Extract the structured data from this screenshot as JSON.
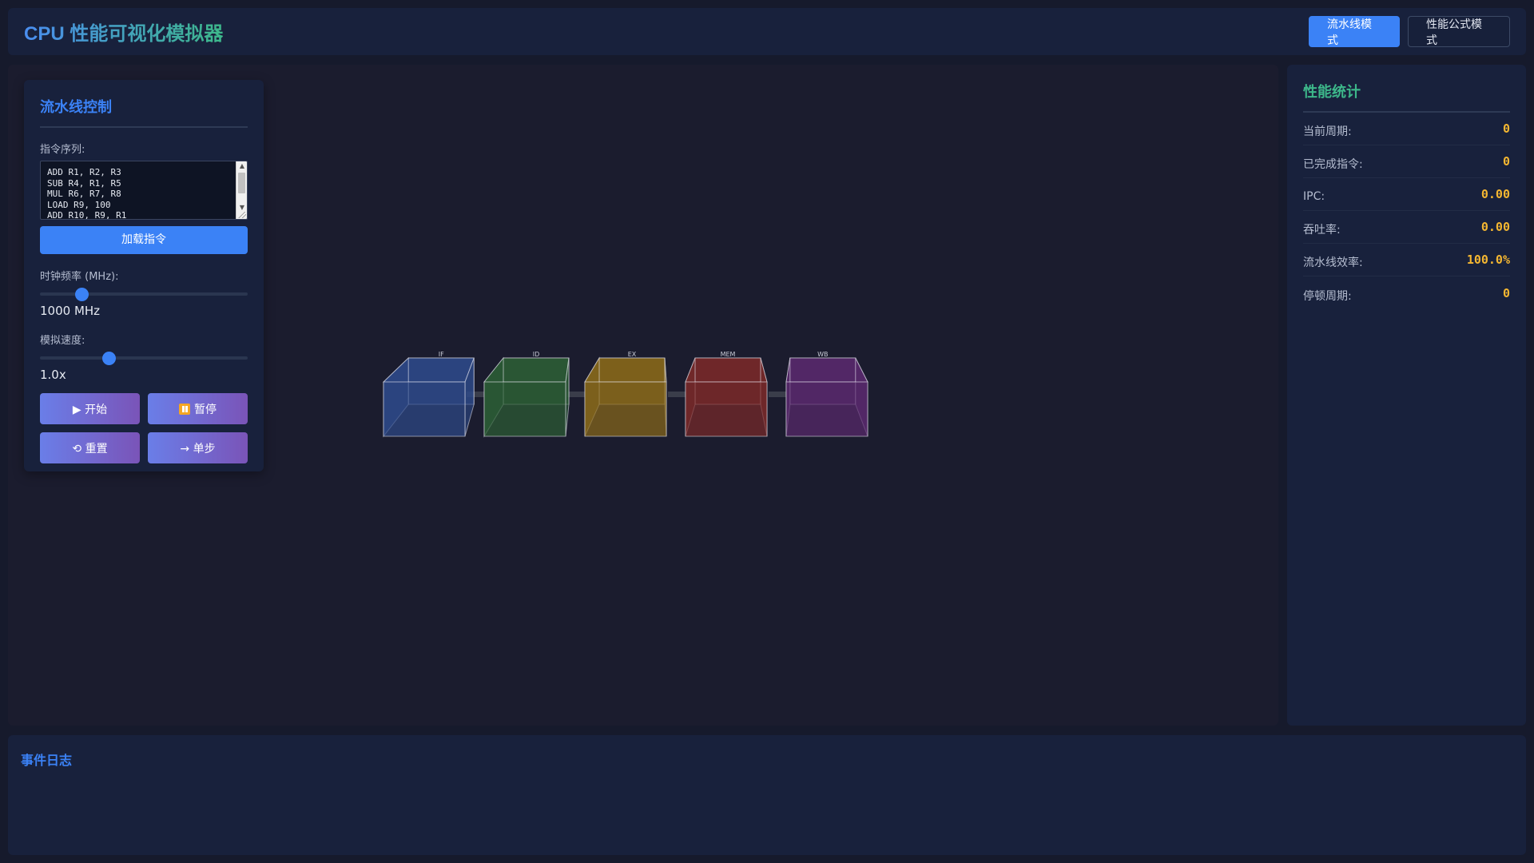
{
  "header": {
    "title": "CPU 性能可视化模拟器",
    "modes": [
      {
        "label": "流水线模式",
        "active": true
      },
      {
        "label": "性能公式模式",
        "active": false
      }
    ]
  },
  "control": {
    "title": "流水线控制",
    "instr_label": "指令序列:",
    "instructions": "ADD R1, R2, R3\nSUB R4, R1, R5\nMUL R6, R7, R8\nLOAD R9, 100\nADD R10, R9, R1",
    "load_label": "加载指令",
    "clock_label": "时钟频率 (MHz):",
    "clock_value": "1000 MHz",
    "clock_fraction": 0.2,
    "speed_label": "模拟速度:",
    "speed_value": "1.0x",
    "speed_fraction": 0.33,
    "buttons": {
      "start": "▶ 开始",
      "pause": "暂停",
      "reset": "⟲ 重置",
      "step": "→ 单步"
    }
  },
  "pipeline": {
    "stages": [
      {
        "label": "IF",
        "color": "#2d4a8a"
      },
      {
        "label": "ID",
        "color": "#2c5e35"
      },
      {
        "label": "EX",
        "color": "#8a6a1a"
      },
      {
        "label": "MEM",
        "color": "#7a2a2a"
      },
      {
        "label": "WB",
        "color": "#5a2a6e"
      }
    ]
  },
  "stats": {
    "title": "性能统计",
    "rows": [
      {
        "label": "当前周期:",
        "value": "0"
      },
      {
        "label": "已完成指令:",
        "value": "0"
      },
      {
        "label": "IPC:",
        "value": "0.00"
      },
      {
        "label": "吞吐率:",
        "value": "0.00"
      },
      {
        "label": "流水线效率:",
        "value": "100.0%"
      },
      {
        "label": "停顿周期:",
        "value": "0"
      }
    ]
  },
  "log": {
    "title": "事件日志"
  },
  "colors": {
    "accent_blue": "#3b82f6",
    "accent_green": "#3db88a",
    "stat_yellow": "#f5b731"
  }
}
